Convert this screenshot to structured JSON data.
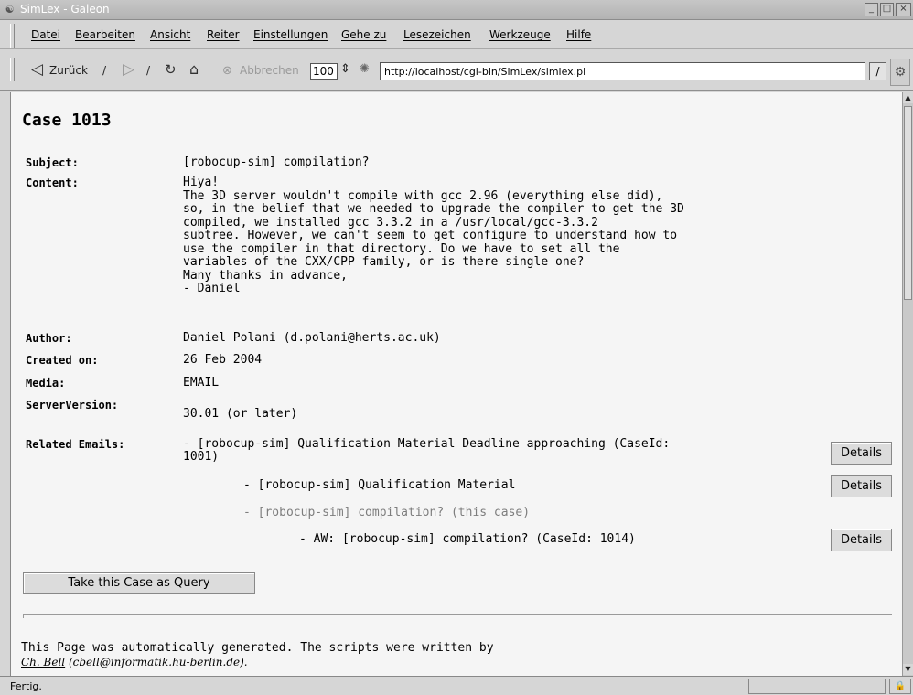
{
  "window": {
    "title": "SimLex - Galeon"
  },
  "menu": [
    "Datei",
    "Bearbeiten",
    "Ansicht",
    "Reiter",
    "Einstellungen",
    "Gehe zu",
    "Lesezeichen",
    "Werkzeuge",
    "Hilfe"
  ],
  "toolbar": {
    "back_label": "Zurück",
    "stop_label": "Abbrechen",
    "zoom_value": "100",
    "url": "http://localhost/cgi-bin/SimLex/simlex.pl"
  },
  "page": {
    "case_title": "Case 1013",
    "subject_label": "Subject:",
    "subject_value": "[robocup-sim] compilation?",
    "content_label": "Content:",
    "content_lines": [
      "Hiya!",
      "The 3D server wouldn't compile with gcc 2.96 (everything else did),",
      "so, in the belief that we needed to upgrade the compiler to get the 3D",
      "compiled, we installed gcc 3.3.2 in a /usr/local/gcc-3.3.2",
      "subtree. However, we can't seem to get configure to understand how to",
      "use the compiler in that directory. Do we have to set all the",
      "variables of the CXX/CPP family, or is there single one?",
      "Many thanks in advance,",
      "- Daniel"
    ],
    "author_label": "Author:",
    "author_value": "Daniel Polani (d.polani@herts.ac.uk)",
    "created_label": "Created on:",
    "created_value": "26 Feb 2004",
    "media_label": "Media:",
    "media_value": "EMAIL",
    "server_label": "ServerVersion:",
    "server_value": "30.01 (or later)",
    "related_label": "Related Emails:",
    "related": [
      {
        "line1": "- [robocup-sim] Qualification Material Deadline approaching (CaseId:",
        "line2": "1001)",
        "details": "Details"
      },
      {
        "line1": "- [robocup-sim] Qualification Material",
        "details": "Details"
      },
      {
        "line1": "- [robocup-sim] compilation? (this case)"
      },
      {
        "line1": "- AW: [robocup-sim] compilation? (CaseId: 1014)",
        "details": "Details"
      }
    ],
    "query_button": "Take this Case as Query",
    "footer_text": "This Page was automatically generated. The scripts were written by",
    "footer_link": "Ch. Bell",
    "footer_email": "(cbell@informatik.hu-berlin.de)."
  },
  "status": {
    "text": "Fertig."
  }
}
